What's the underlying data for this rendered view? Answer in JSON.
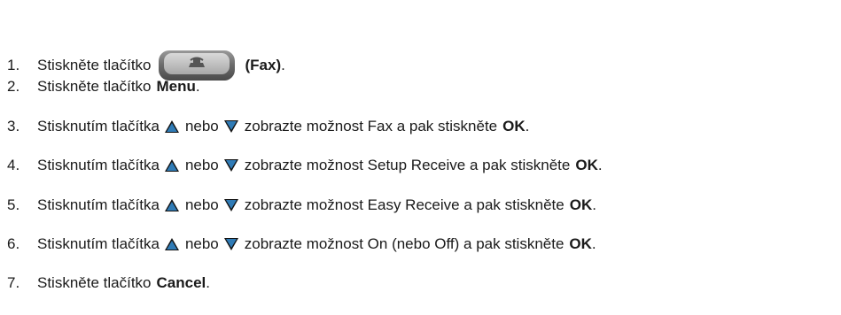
{
  "steps": [
    {
      "num": "1.",
      "text_before": "Stiskněte tlačítko",
      "key_icon": "fax-key-icon",
      "key_label": "(Fax)",
      "text_after": "."
    },
    {
      "num": "2.",
      "text_before": "Stiskněte tlačítko",
      "bold": "Menu",
      "text_after": "."
    },
    {
      "num": "3.",
      "text_before": "Stisknutím tlačítka",
      "mid": "nebo",
      "text_after": "zobrazte možnost Fax a pak stiskněte",
      "bold": "OK",
      "end": "."
    },
    {
      "num": "4.",
      "text_before": "Stisknutím tlačítka",
      "mid": "nebo",
      "text_after": "zobrazte možnost Setup Receive a pak stiskněte",
      "bold": "OK",
      "end": "."
    },
    {
      "num": "5.",
      "text_before": "Stisknutím tlačítka",
      "mid": "nebo",
      "text_after": "zobrazte možnost Easy Receive a pak stiskněte",
      "bold": "OK",
      "end": "."
    },
    {
      "num": "6.",
      "text_before": "Stisknutím tlačítka",
      "mid": "nebo",
      "text_after": "zobrazte možnost On (nebo Off) a pak stiskněte",
      "bold": "OK",
      "end": "."
    },
    {
      "num": "7.",
      "text_before": "Stiskněte tlačítko",
      "bold": "Cancel",
      "text_after": "."
    }
  ],
  "icons": {
    "up": "up-arrow-icon",
    "down": "down-arrow-icon"
  },
  "colors": {
    "text": "#1a1a1a",
    "arrow_fill": "#2f7bb6",
    "key_gray": "#6e6e6e"
  }
}
